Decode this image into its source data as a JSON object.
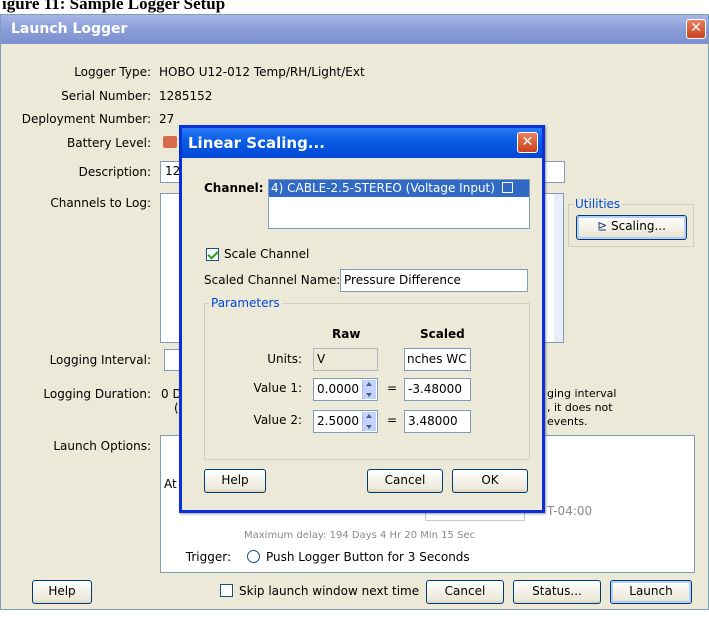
{
  "doc_heading": "igure 11: Sample Logger Setup",
  "window": {
    "title": "Launch Logger",
    "close_symbol": "✕",
    "logger_type_label": "Logger Type:",
    "logger_type_value": "HOBO U12-012 Temp/RH/Light/Ext",
    "serial_number_label": "Serial Number:",
    "serial_number_value": "1285152",
    "deployment_number_label": "Deployment Number:",
    "deployment_number_value": "27",
    "battery_level_label": "Battery Level:",
    "description_label": "Description:",
    "description_value": "12",
    "channels_to_log_label": "Channels to Log:",
    "utilities_label": "Utilities",
    "scaling_button": "Scaling...",
    "logging_interval_label": "Logging Interval:",
    "logging_duration_label": "Logging Duration:",
    "logging_duration_value": "0 D",
    "logging_duration_value_2": "(",
    "note_lines": [
      "ging interval",
      ", it does not",
      "events."
    ],
    "launch_options_label": "Launch Options:",
    "at_label": "At",
    "timezone_text": "T-04:00",
    "max_delay_text": "Maximum delay: 194 Days  4 Hr 20 Min 15 Sec",
    "trigger_label": "Trigger:",
    "trigger_option": "Push Logger Button for 3 Seconds",
    "help_button": "Help",
    "skip_launch_label": "Skip launch window next time",
    "cancel_button": "Cancel",
    "status_button": "Status...",
    "launch_button": "Launch"
  },
  "dialog": {
    "title": "Linear Scaling...",
    "close_symbol": "✕",
    "channel_label": "Channel:",
    "channel_selected": "4) CABLE-2.5-STEREO (Voltage Input)",
    "scale_channel_label": "Scale Channel",
    "scale_channel_checked": true,
    "scaled_name_label": "Scaled Channel Name:",
    "scaled_name_value": "Pressure Difference",
    "parameters_label": "Parameters",
    "raw_header": "Raw",
    "scaled_header": "Scaled",
    "units_label": "Units:",
    "units_raw": "V",
    "units_scaled": "nches WC",
    "value1_label": "Value 1:",
    "value1_raw": "0.0000",
    "value1_scaled": "-3.48000",
    "value2_label": "Value 2:",
    "value2_raw": "2.5000",
    "value2_scaled": "3.48000",
    "equals": "=",
    "help_button": "Help",
    "cancel_button": "Cancel",
    "ok_button": "OK"
  }
}
